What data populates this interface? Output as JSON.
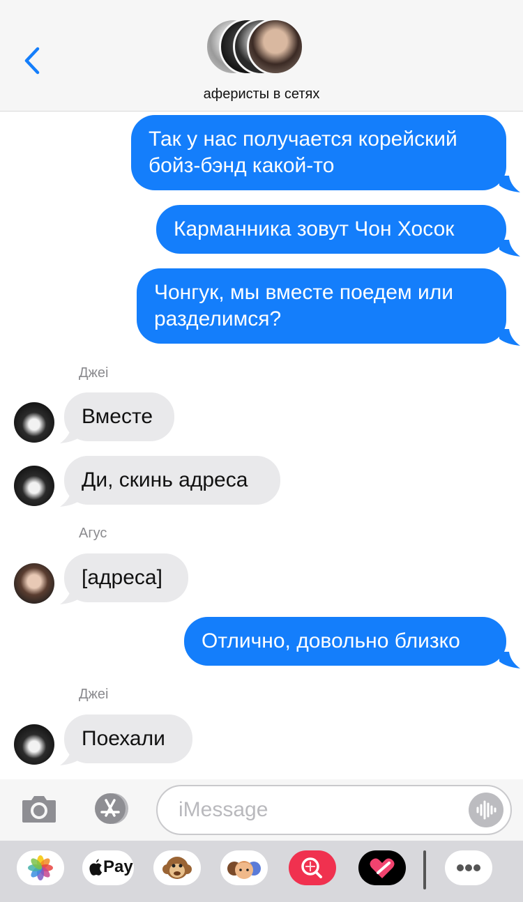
{
  "header": {
    "group_name": "аферисты в сетях",
    "back_icon": "chevron-left-icon"
  },
  "messages": [
    {
      "direction": "outgoing",
      "lines": [
        "Так у нас получается корейский",
        "бойз-бэнд какой-то"
      ]
    },
    {
      "direction": "outgoing",
      "lines": [
        "Карманника зовут Чон Хосок"
      ]
    },
    {
      "direction": "outgoing",
      "lines": [
        "Чонгук, мы вместе поедем или",
        "разделимся?"
      ]
    },
    {
      "direction": "incoming",
      "sender": "Джеі",
      "lines": [
        "Вместе"
      ]
    },
    {
      "direction": "incoming",
      "lines": [
        "Ди, скинь адреса"
      ]
    },
    {
      "direction": "incoming",
      "sender": "Агус",
      "lines": [
        "[адреса]"
      ]
    },
    {
      "direction": "outgoing",
      "lines": [
        "Отлично, довольно близко"
      ]
    },
    {
      "direction": "incoming",
      "sender": "Джеі",
      "lines": [
        "Поехали"
      ]
    }
  ],
  "input": {
    "placeholder": "iMessage",
    "value": ""
  },
  "drawer": {
    "apple_pay_label": "Pay",
    "apps": [
      "photos-icon",
      "apple-pay-icon",
      "monkey-memoji-icon",
      "memoji-icon",
      "search-images-icon",
      "digital-touch-icon",
      "more-icon"
    ]
  },
  "colors": {
    "outgoing_bubble": "#147efb",
    "incoming_bubble": "#e9e9eb",
    "accent": "#147efb"
  }
}
